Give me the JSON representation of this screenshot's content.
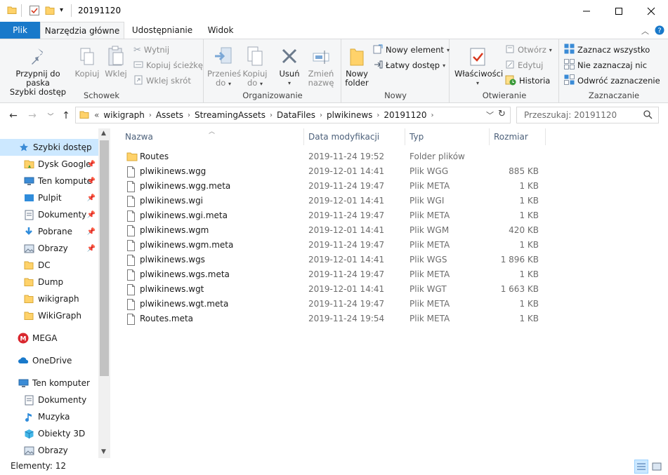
{
  "window": {
    "title": "20191120",
    "colors": {
      "accent": "#1979ca",
      "selection": "#cce8ff",
      "folder": "#ffd26a"
    }
  },
  "tabs": [
    "Plik",
    "Narzędzia główne",
    "Udostępnianie",
    "Widok"
  ],
  "ribbon": {
    "schowek": {
      "label": "Schowek",
      "pin": "Przypnij do paska\nSzybki dostęp",
      "copy": "Kopiuj",
      "paste": "Wklej",
      "cut": "Wytnij",
      "copy_path": "Kopiuj ścieżkę",
      "paste_shortcut": "Wklej skrót"
    },
    "organizowanie": {
      "label": "Organizowanie",
      "move_to": "Przenieś\ndo",
      "copy_to": "Kopiuj\ndo",
      "delete": "Usuń",
      "rename": "Zmień\nnazwę"
    },
    "nowy": {
      "label": "Nowy",
      "new_folder": "Nowy\nfolder",
      "new_item": "Nowy element",
      "easy_access": "Łatwy dostęp"
    },
    "otwieranie": {
      "label": "Otwieranie",
      "properties": "Właściwości",
      "open": "Otwórz",
      "edit": "Edytuj",
      "history": "Historia"
    },
    "zaznaczanie": {
      "label": "Zaznaczanie",
      "select_all": "Zaznacz wszystko",
      "select_none": "Nie zaznaczaj nic",
      "invert": "Odwróć zaznaczenie"
    }
  },
  "address": {
    "overflow": "«",
    "breadcrumbs": [
      "wikigraph",
      "Assets",
      "StreamingAssets",
      "DataFiles",
      "plwikinews",
      "20191120"
    ],
    "search_placeholder": "Przeszukaj: 20191120"
  },
  "nav": {
    "items": [
      {
        "label": "Szybki dostęp",
        "icon": "star-icon",
        "pinned": false,
        "selected": true
      },
      {
        "label": "Dysk Google",
        "icon": "google-drive-icon",
        "pinned": true
      },
      {
        "label": "Ten kompute",
        "icon": "computer-icon",
        "pinned": true
      },
      {
        "label": "Pulpit",
        "icon": "desktop-icon",
        "pinned": true
      },
      {
        "label": "Dokumenty",
        "icon": "documents-icon",
        "pinned": true
      },
      {
        "label": "Pobrane",
        "icon": "download-icon",
        "pinned": true
      },
      {
        "label": "Obrazy",
        "icon": "pictures-icon",
        "pinned": true
      },
      {
        "label": "DC",
        "icon": "folder-icon",
        "pinned": false
      },
      {
        "label": "Dump",
        "icon": "folder-icon",
        "pinned": false
      },
      {
        "label": "wikigraph",
        "icon": "folder-icon",
        "pinned": false
      },
      {
        "label": "WikiGraph",
        "icon": "folder-icon",
        "pinned": false
      },
      {
        "label": "MEGA",
        "icon": "mega-icon",
        "pinned": false
      },
      {
        "label": "OneDrive",
        "icon": "onedrive-icon",
        "pinned": false
      },
      {
        "label": "Ten komputer",
        "icon": "computer-icon",
        "pinned": false
      },
      {
        "label": "Dokumenty",
        "icon": "documents-icon",
        "pinned": false
      },
      {
        "label": "Muzyka",
        "icon": "music-icon",
        "pinned": false
      },
      {
        "label": "Obiekty 3D",
        "icon": "objects-3d-icon",
        "pinned": false
      },
      {
        "label": "Obrazy",
        "icon": "pictures-icon",
        "pinned": false
      }
    ]
  },
  "columns": {
    "name": "Nazwa",
    "date": "Data modyfikacji",
    "type": "Typ",
    "size": "Rozmiar"
  },
  "files": [
    {
      "name": "Routes",
      "date": "2019-11-24 19:52",
      "type": "Folder plików",
      "size": "",
      "kind": "folder"
    },
    {
      "name": "plwikinews.wgg",
      "date": "2019-12-01 14:41",
      "type": "Plik WGG",
      "size": "885 KB",
      "kind": "file"
    },
    {
      "name": "plwikinews.wgg.meta",
      "date": "2019-11-24 19:47",
      "type": "Plik META",
      "size": "1 KB",
      "kind": "file"
    },
    {
      "name": "plwikinews.wgi",
      "date": "2019-12-01 14:41",
      "type": "Plik WGI",
      "size": "1 KB",
      "kind": "file"
    },
    {
      "name": "plwikinews.wgi.meta",
      "date": "2019-11-24 19:47",
      "type": "Plik META",
      "size": "1 KB",
      "kind": "file"
    },
    {
      "name": "plwikinews.wgm",
      "date": "2019-12-01 14:41",
      "type": "Plik WGM",
      "size": "420 KB",
      "kind": "file"
    },
    {
      "name": "plwikinews.wgm.meta",
      "date": "2019-11-24 19:47",
      "type": "Plik META",
      "size": "1 KB",
      "kind": "file"
    },
    {
      "name": "plwikinews.wgs",
      "date": "2019-12-01 14:41",
      "type": "Plik WGS",
      "size": "1 896 KB",
      "kind": "file"
    },
    {
      "name": "plwikinews.wgs.meta",
      "date": "2019-11-24 19:47",
      "type": "Plik META",
      "size": "1 KB",
      "kind": "file"
    },
    {
      "name": "plwikinews.wgt",
      "date": "2019-12-01 14:41",
      "type": "Plik WGT",
      "size": "1 663 KB",
      "kind": "file"
    },
    {
      "name": "plwikinews.wgt.meta",
      "date": "2019-11-24 19:47",
      "type": "Plik META",
      "size": "1 KB",
      "kind": "file"
    },
    {
      "name": "Routes.meta",
      "date": "2019-11-24 19:54",
      "type": "Plik META",
      "size": "1 KB",
      "kind": "file"
    }
  ],
  "status": {
    "items": "Elementy: 12"
  }
}
